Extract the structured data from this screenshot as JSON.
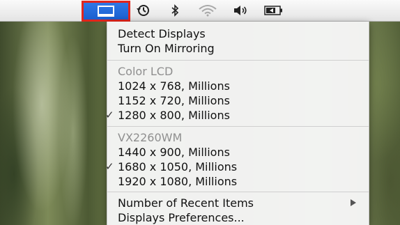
{
  "menubar": {
    "icons": [
      {
        "name": "displays-icon",
        "active": true
      },
      {
        "name": "time-machine-icon"
      },
      {
        "name": "bluetooth-icon"
      },
      {
        "name": "wifi-icon"
      },
      {
        "name": "volume-icon"
      },
      {
        "name": "battery-icon"
      }
    ],
    "highlight_color": "#e2251c",
    "active_color": "#1a5fcf"
  },
  "menu": {
    "actions": {
      "detect_displays": "Detect Displays",
      "turn_on_mirroring": "Turn On Mirroring"
    },
    "displays": [
      {
        "name": "Color LCD",
        "resolutions": [
          {
            "label": "1024 x 768, Millions",
            "checked": false
          },
          {
            "label": "1152 x 720, Millions",
            "checked": false
          },
          {
            "label": "1280 x 800, Millions",
            "checked": true
          }
        ]
      },
      {
        "name": "VX2260WM",
        "resolutions": [
          {
            "label": "1440 x 900, Millions",
            "checked": false
          },
          {
            "label": "1680 x 1050, Millions",
            "checked": true
          },
          {
            "label": "1920 x 1080, Millions",
            "checked": false
          }
        ]
      }
    ],
    "footer": {
      "recent_items": "Number of Recent Items",
      "preferences": "Displays Preferences..."
    },
    "check_glyph": "✓"
  }
}
